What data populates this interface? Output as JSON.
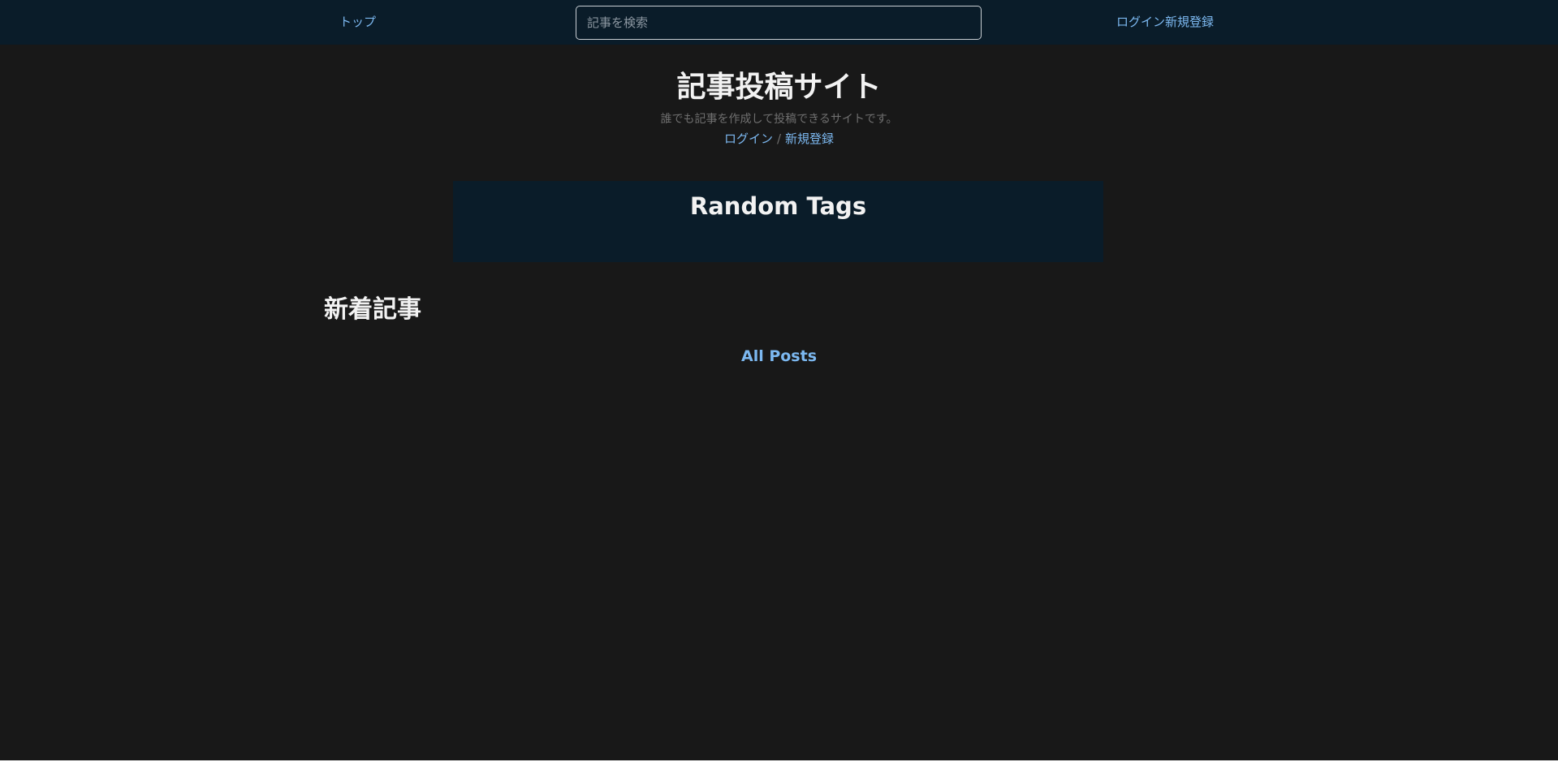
{
  "navbar": {
    "top_label": "トップ",
    "search_placeholder": "記事を検索",
    "search_value": "",
    "login_label": "ログイン",
    "register_label": "新規登録"
  },
  "hero": {
    "title": "記事投稿サイト",
    "subtitle": "誰でも記事を作成して投稿できるサイトです。",
    "login_label": "ログイン",
    "separator": "/",
    "register_label": "新規登録"
  },
  "tags": {
    "title": "Random Tags",
    "items": []
  },
  "recent": {
    "title": "新着記事",
    "items": [],
    "all_posts_label": "All Posts"
  },
  "colors": {
    "background": "#181818",
    "header": "#0a1c29",
    "link": "#7cb8f0",
    "heading": "#f2f2f2",
    "muted_text": "#6f6f6f",
    "input_border": "#c9ced3"
  }
}
